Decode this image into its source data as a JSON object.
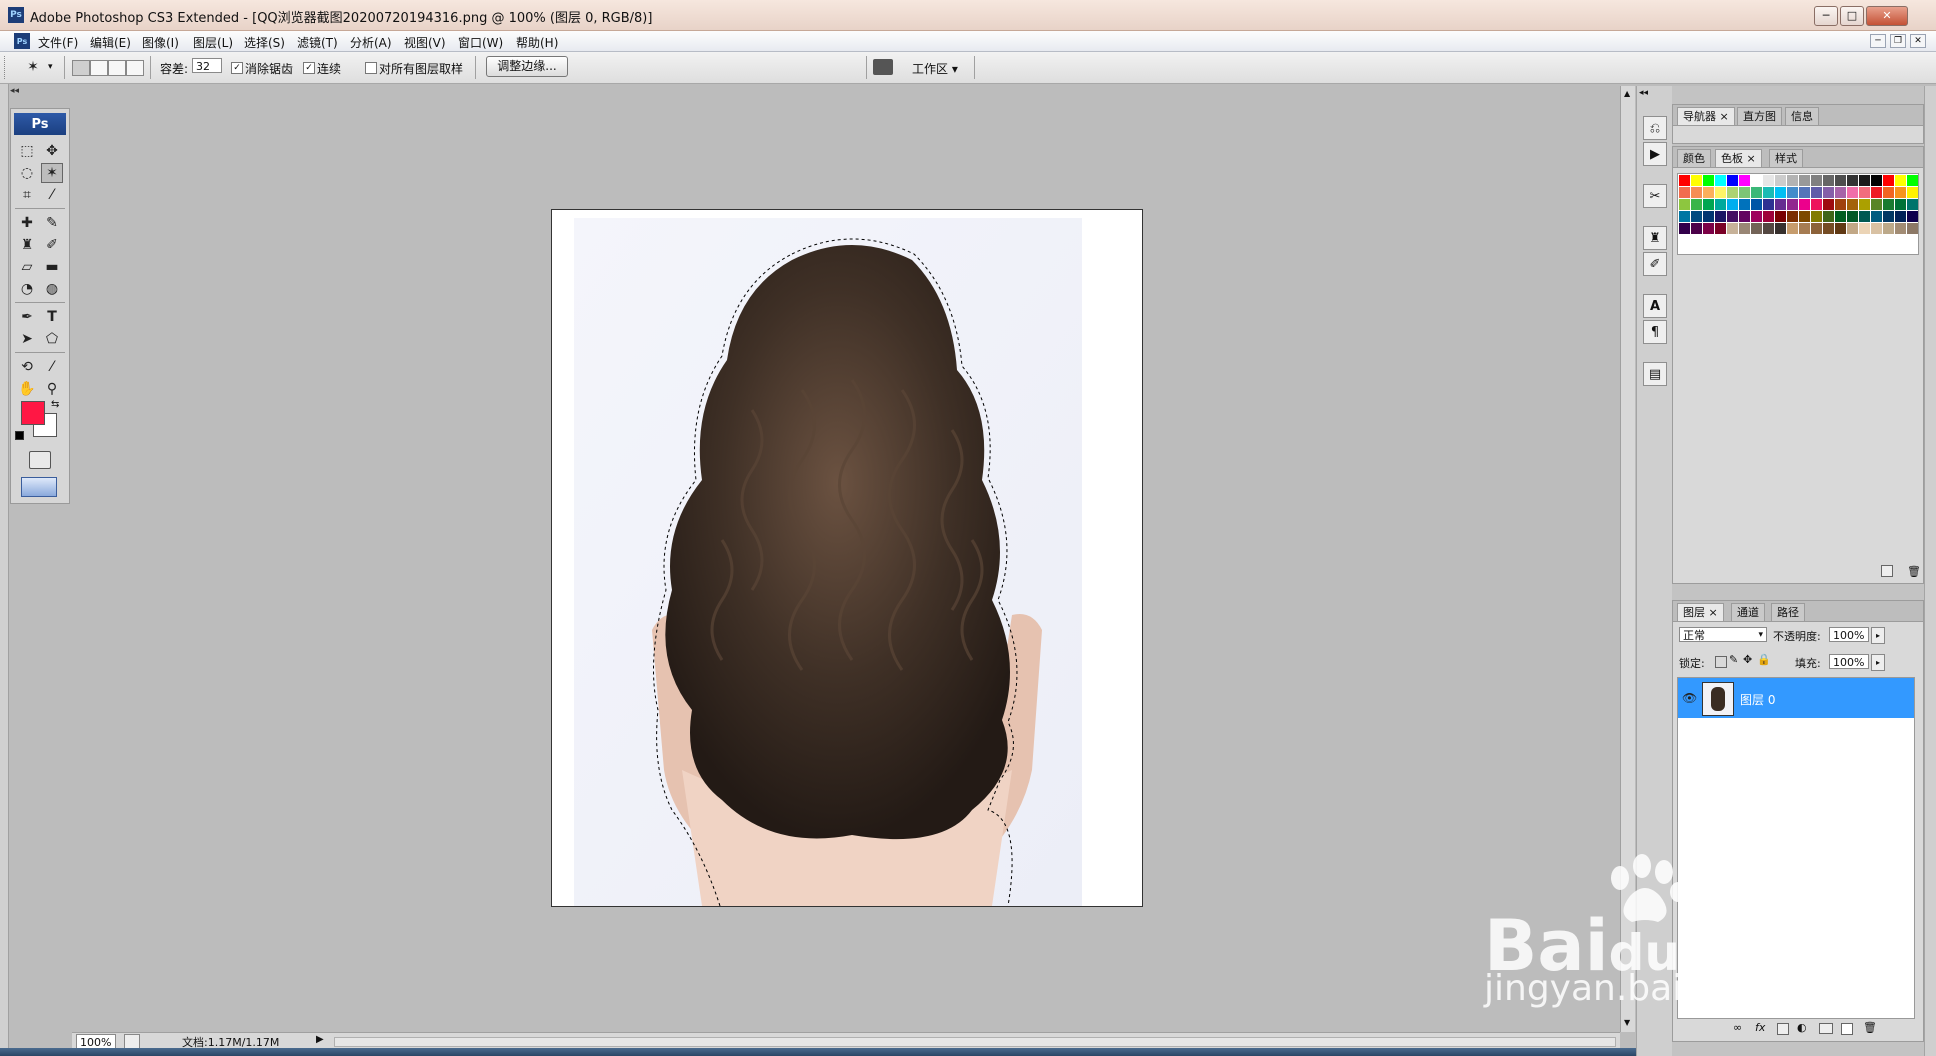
{
  "window": {
    "title": "Adobe Photoshop CS3 Extended - [QQ浏览器截图20200720194316.png @ 100% (图层 0, RGB/8)]",
    "app_icon_label": "Ps",
    "minimize": "─",
    "maximize": "□",
    "close": "✕"
  },
  "menu": {
    "app_icon_label": "Ps",
    "items": [
      "文件(F)",
      "编辑(E)",
      "图像(I)",
      "图层(L)",
      "选择(S)",
      "滤镜(T)",
      "分析(A)",
      "视图(V)",
      "窗口(W)",
      "帮助(H)"
    ],
    "doc_controls": [
      "─",
      "❐",
      "✕"
    ]
  },
  "options": {
    "tolerance_label": "容差:",
    "tolerance_value": "32",
    "antialias_label": "消除锯齿",
    "antialias_checked": "✓",
    "contiguous_label": "连续",
    "contiguous_checked": "✓",
    "sample_all_label": "对所有图层取样",
    "refine_edge_label": "调整边缘...",
    "workspace_label": "工作区 ▾"
  },
  "toolbox": {
    "logo": "Ps",
    "foreground_color": "#ff1744",
    "background_color": "#ffffff"
  },
  "status": {
    "zoom": "100%",
    "doc_info": "文档:1.17M/1.17M"
  },
  "panels": {
    "navigator_tabs": [
      "导航器",
      "直方图",
      "信息"
    ],
    "color_tabs": [
      "颜色",
      "色板",
      "样式"
    ],
    "layers_tabs": [
      "图层",
      "通道",
      "路径"
    ],
    "blend_mode": "正常",
    "opacity_label": "不透明度:",
    "opacity_value": "100%",
    "lock_label": "锁定:",
    "fill_label": "填充:",
    "fill_value": "100%",
    "layer_name": "图层 0"
  },
  "swatches": [
    "#ff0000",
    "#ffff00",
    "#00ff00",
    "#00ffff",
    "#0000ff",
    "#ff00ff",
    "#ffffff",
    "#e6e6e6",
    "#cccccc",
    "#b3b3b3",
    "#999999",
    "#808080",
    "#666666",
    "#4d4d4d",
    "#333333",
    "#1a1a1a",
    "#000000",
    "#ff0000",
    "#ffff00",
    "#00ff00",
    "#f26c4f",
    "#f68e55",
    "#fbaf5c",
    "#fff467",
    "#acd372",
    "#7cc576",
    "#3bb878",
    "#1abbb4",
    "#00bff3",
    "#438ccb",
    "#5574b9",
    "#605ca8",
    "#855fa8",
    "#a763a8",
    "#f06ea9",
    "#f26d7d",
    "#ed1c24",
    "#f26522",
    "#f7941d",
    "#fff200",
    "#8dc63f",
    "#39b54a",
    "#00a651",
    "#00a99d",
    "#00aeef",
    "#0072bc",
    "#0054a6",
    "#2e3192",
    "#662d91",
    "#92278f",
    "#ec008c",
    "#ed145b",
    "#9e0b0f",
    "#a0410d",
    "#a3620a",
    "#aba000",
    "#598527",
    "#197b30",
    "#007236",
    "#00746b",
    "#0076a3",
    "#004a80",
    "#003471",
    "#1b1464",
    "#440e62",
    "#630460",
    "#9e005d",
    "#9e0039",
    "#790000",
    "#7b2e00",
    "#7d4900",
    "#827b00",
    "#406618",
    "#005e20",
    "#005826",
    "#005952",
    "#005b7f",
    "#003663",
    "#002157",
    "#0d004c",
    "#32004b",
    "#4b0049",
    "#7b0046",
    "#7a0026",
    "#c7b299",
    "#998675",
    "#736357",
    "#534741",
    "#37302d",
    "#c69c6d",
    "#a67c52",
    "#8c6239",
    "#754c24",
    "#603913",
    "#c2a886",
    "#ebd4b6",
    "#d8c1a3",
    "#bca98a",
    "#a28c74",
    "#8c7866"
  ]
}
